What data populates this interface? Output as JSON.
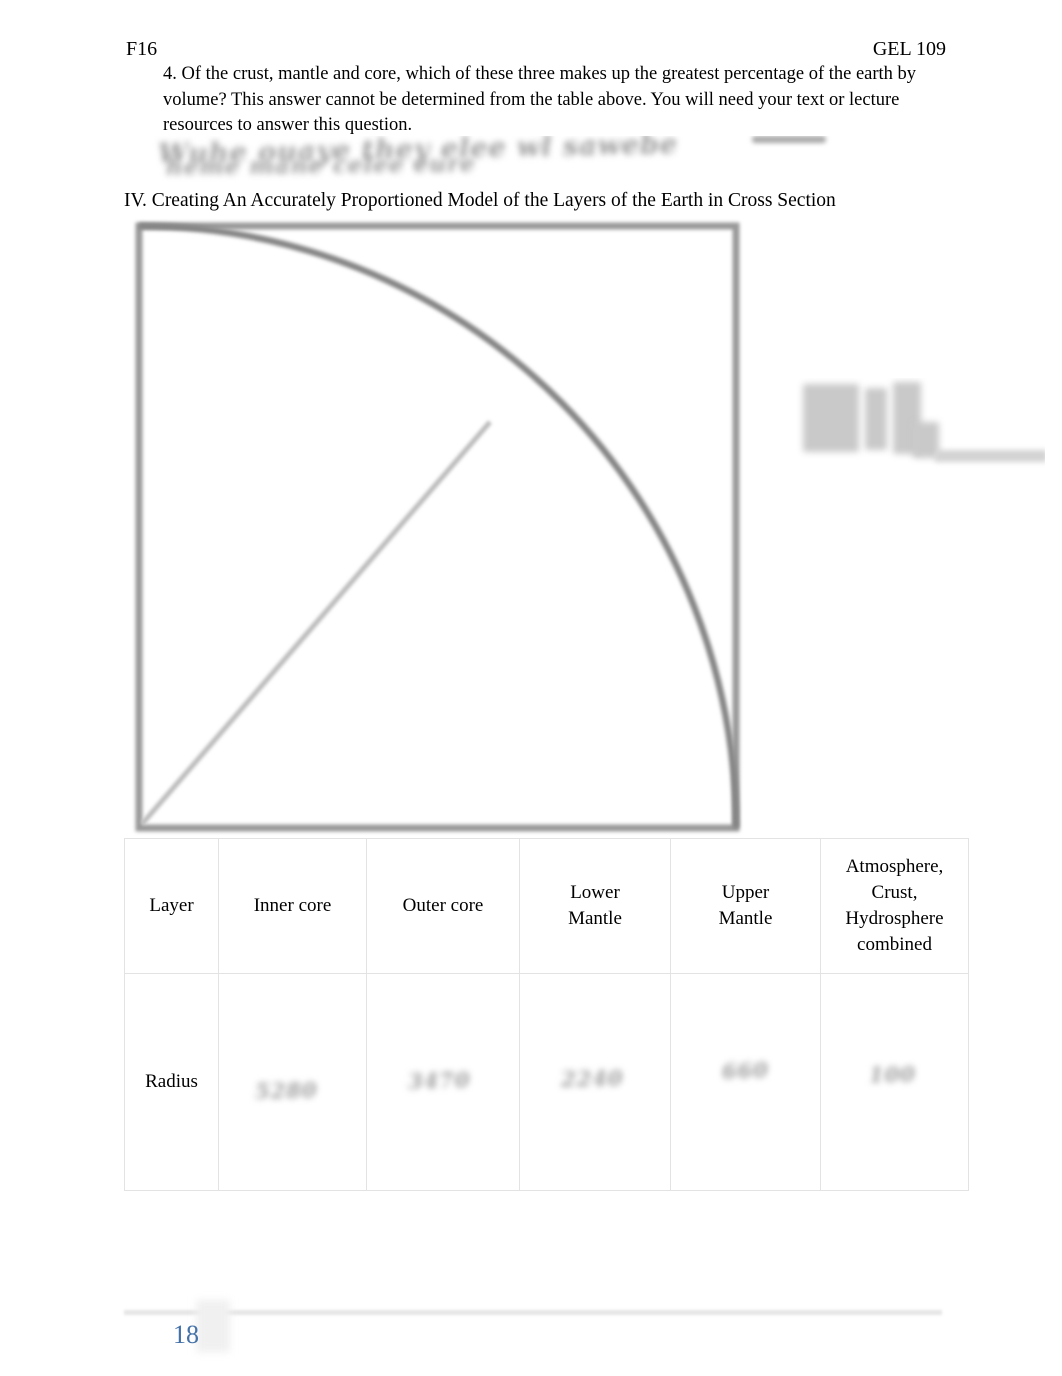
{
  "document": {
    "running_head": {
      "left": "F16",
      "right": "GEL 109"
    },
    "question": {
      "number": "4.",
      "text": "4. Of the crust, mantle and core, which of these three makes up the greatest percentage of the earth by volume?   This answer cannot be determined from the table above. You will need your text or lecture resources to answer this question."
    },
    "handwritten_answer": {
      "line1": "illegible handwritten response",
      "line2": "illegible handwritten response",
      "legible": "false"
    },
    "section_heading": "IV. Creating An Accurately Proportioned Model of the Layers of the Earth in Cross Section",
    "margin_annotation": {
      "content": "illegible faint annotation",
      "legible": "false"
    },
    "diagram": {
      "name": "earth-cross-section-quarter-circle",
      "description": "Square frame with a quarter-circle arc from top-left to bottom-right and a diagonal radius line from the bottom-left corner to the arc",
      "frame_color": "#9a9a9a",
      "arc_color": "#8a8a8a",
      "radius_line_color": "#b5b5b5"
    },
    "table": {
      "row_labels": [
        "Layer",
        "Radius"
      ],
      "columns": [
        "Inner core",
        "Outer core",
        "Lower\nMantle",
        "Upper\nMantle",
        "Atmosphere,\nCrust,\nHydrosphere\ncombined"
      ],
      "columns_flat": [
        {
          "line1": "Inner core",
          "line2": "",
          "line3": "",
          "line4": ""
        },
        {
          "line1": "Outer core",
          "line2": "",
          "line3": "",
          "line4": ""
        },
        {
          "line1": "Lower",
          "line2": "Mantle",
          "line3": "",
          "line4": ""
        },
        {
          "line1": "Upper",
          "line2": "Mantle",
          "line3": "",
          "line4": ""
        },
        {
          "line1": "Atmosphere,",
          "line2": "Crust,",
          "line3": "Hydrosphere",
          "line4": "combined"
        }
      ],
      "radius_values": [
        {
          "value": "illegible",
          "legible": "false"
        },
        {
          "value": "illegible",
          "legible": "false"
        },
        {
          "value": "illegible",
          "legible": "false"
        },
        {
          "value": "illegible",
          "legible": "false"
        },
        {
          "value": "illegible",
          "legible": "false"
        }
      ],
      "border_color": "#e3e3e3"
    },
    "footer": {
      "page_number": "18",
      "page_number_color": "#4472a8",
      "rule_color": "#e6e6e6"
    }
  }
}
